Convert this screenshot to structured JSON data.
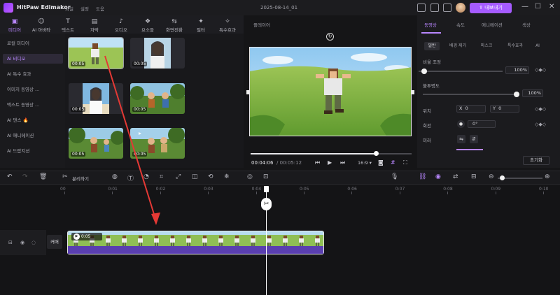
{
  "titlebar": {
    "app_name": "HitPaw Edimakor",
    "menus": [
      "파일",
      "설정",
      "도움"
    ],
    "project_title": "2025-08-14_01",
    "export_label": "내보내기"
  },
  "media_tabs": [
    {
      "label": "미디어",
      "icon": "media-icon",
      "active": true
    },
    {
      "label": "AI 아바타",
      "icon": "ai-avatar-icon",
      "active": false
    },
    {
      "label": "텍스트",
      "icon": "text-icon",
      "active": false
    },
    {
      "label": "자막",
      "icon": "subtitle-icon",
      "active": false
    },
    {
      "label": "오디오",
      "icon": "audio-icon",
      "active": false
    },
    {
      "label": "요소들",
      "icon": "elements-icon",
      "active": false
    },
    {
      "label": "화면전환",
      "icon": "transition-icon",
      "active": false
    },
    {
      "label": "필터",
      "icon": "filter-icon",
      "active": false
    },
    {
      "label": "특수효과",
      "icon": "effects-icon",
      "active": false
    }
  ],
  "sidebar": {
    "items": [
      {
        "label": "로컬 미디어",
        "active": false
      },
      {
        "label": "AI 비디오",
        "active": true
      },
      {
        "label": "AI 특수 효과",
        "active": false
      },
      {
        "label": "이미지 동영상 ...",
        "active": false
      },
      {
        "label": "텍스트 동영상 ...",
        "active": false
      },
      {
        "label": "AI 댄스 🔥",
        "active": false
      },
      {
        "label": "AI 애니메이션",
        "active": false
      },
      {
        "label": "AI 드랍지션",
        "active": false
      }
    ]
  },
  "media_items": [
    {
      "duration": "00:05",
      "kind": "pixel-character"
    },
    {
      "duration": "00:05",
      "kind": "woman-portrait"
    },
    {
      "duration": "00:05",
      "kind": "woman-beach"
    },
    {
      "duration": "00:05",
      "kind": "kids-forest"
    },
    {
      "duration": "00:05",
      "kind": "kids-forest-2"
    },
    {
      "duration": "00:05",
      "kind": "kids-forest-3"
    }
  ],
  "player": {
    "label": "플레이어",
    "current_time": "00:04:06",
    "total_time": "00:05:12",
    "progress": 0.78,
    "aspect_ratio": "16:9"
  },
  "right_panel": {
    "tabs": [
      {
        "label": "동영상",
        "active": true
      },
      {
        "label": "속도",
        "active": false
      },
      {
        "label": "애니메이션",
        "active": false
      },
      {
        "label": "색상",
        "active": false
      }
    ],
    "subtabs": [
      {
        "label": "일반",
        "active": true
      },
      {
        "label": "배경 제거",
        "active": false
      },
      {
        "label": "마스크",
        "active": false
      },
      {
        "label": "특수효과",
        "active": false
      },
      {
        "label": "AI",
        "active": false
      }
    ],
    "scale_label": "비율 조정",
    "scale_value": "100%",
    "scale_level": 1.0,
    "opacity_label": "불투명도",
    "opacity_value": "100%",
    "opacity_level": 1.0,
    "position_label": "위치",
    "pos_x_label": "X",
    "pos_x": "0",
    "pos_y_label": "Y",
    "pos_y": "0",
    "rotate_label": "회전",
    "rotate_value": "0°",
    "mirror_label": "미러",
    "reset_label": "초기화"
  },
  "toolbar": {
    "split_label": "분리하기"
  },
  "timeline": {
    "ticks": [
      "00",
      "0:01",
      "0:02",
      "0:03",
      "0:04",
      "0:05",
      "0:06",
      "0:07",
      "0:08",
      "0:09",
      "0:10"
    ],
    "track_label": "커버",
    "clip_duration": "0:05"
  },
  "colors": {
    "accent": "#b987ff",
    "export": "#a55bff",
    "clip_bar": "#5a3fb0"
  }
}
